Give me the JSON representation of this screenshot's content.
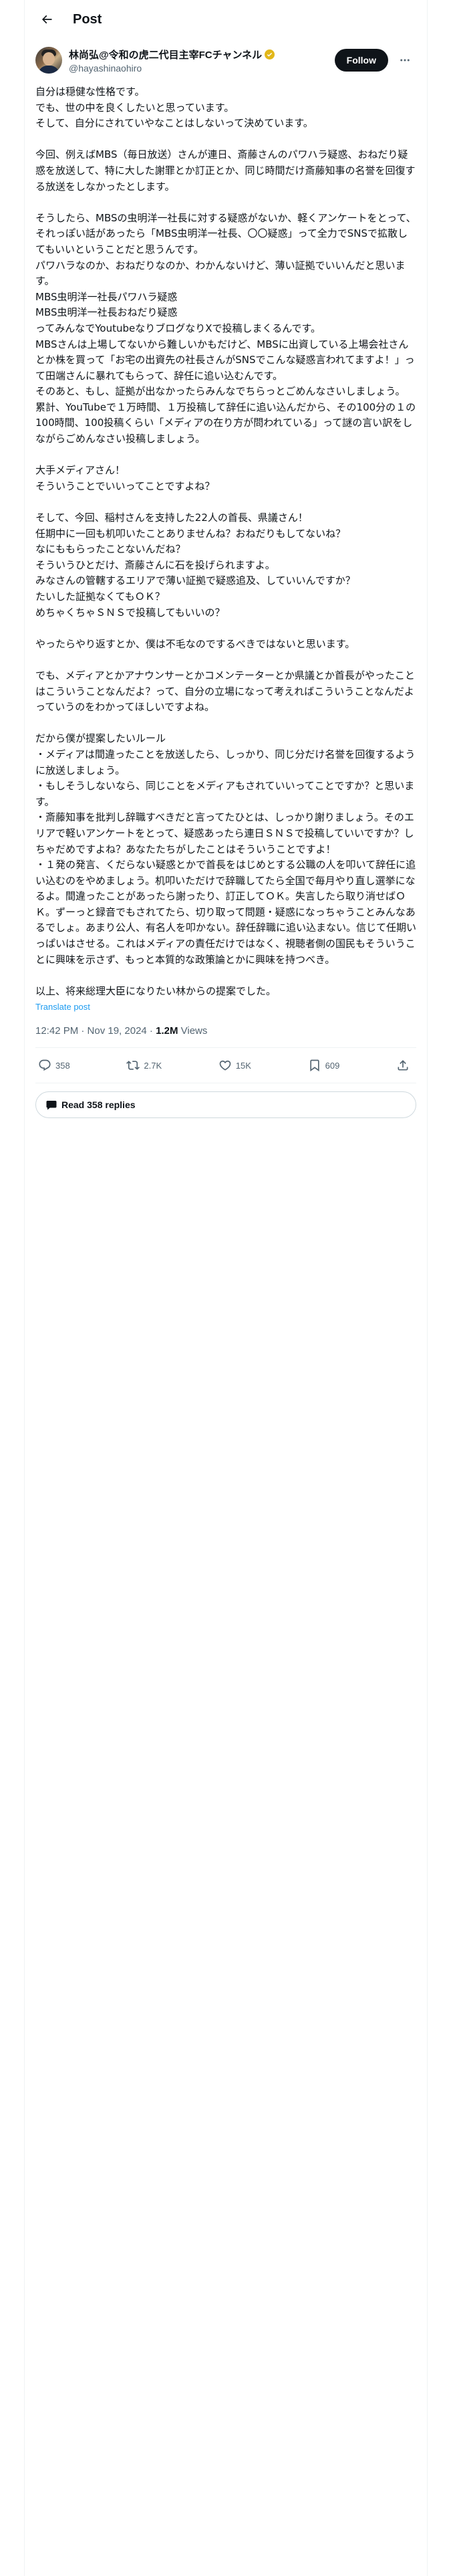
{
  "header": {
    "title": "Post"
  },
  "author": {
    "display_name": "林尚弘@令和の虎二代目主宰FCチャンネル",
    "handle": "@hayashinaohiro",
    "follow_label": "Follow",
    "badge_color": "#e2b719"
  },
  "post": {
    "text": "自分は穏健な性格です。\nでも、世の中を良くしたいと思っています。\nそして、自分にされていやなことはしないって決めています。\n\n今回、例えばMBS（毎日放送）さんが連日、斎藤さんのパワハラ疑惑、おねだり疑惑を放送して、特に大した謝罪とか訂正とか、同じ時間だけ斎藤知事の名誉を回復する放送をしなかったとします。\n\nそうしたら、MBSの虫明洋一社長に対する疑惑がないか、軽くアンケートをとって、それっぽい話があったら「MBS虫明洋一社長、〇〇疑惑」って全力でSNSで拡散してもいいということだと思うんです。\nパワハラなのか、おねだりなのか、わかんないけど、薄い証拠でいいんだと思います。\nMBS虫明洋一社長パワハラ疑惑\nMBS虫明洋一社長おねだり疑惑\nってみんなでYoutubeなりブログなりXで投稿しまくるんです。\nMBSさんは上場してないから難しいかもだけど、MBSに出資している上場会社さんとか株を買って「お宅の出資先の社長さんがSNSでこんな疑惑言われてますよ！」って田端さんに暴れてもらって、辞任に追い込むんです。\nそのあと、もし、証拠が出なかったらみんなでちらっとごめんなさいしましょう。\n累計、YouTubeで１万時間、１万投稿して辞任に追い込んだから、その100分の１の100時間、100投稿くらい「メディアの在り方が問われている」って謎の言い訳をしながらごめんなさい投稿しましょう。\n\n大手メディアさん！\nそういうことでいいってことですよね？\n\nそして、今回、稲村さんを支持した22人の首長、県議さん！\n任期中に一回も机叩いたことありませんね？おねだりもしてないね？\nなにももらったことないんだね？\nそういうひとだけ、斎藤さんに石を投げられますよ。\nみなさんの管轄するエリアで薄い証拠で疑惑追及、していいんですか？\nたいした証拠なくてもＯＫ？\nめちゃくちゃＳＮＳで投稿してもいいの？\n\nやったらやり返すとか、僕は不毛なのでするべきではないと思います。\n\nでも、メディアとかアナウンサーとかコメンテーターとか県議とか首長がやったことはこういうことなんだよ？って、自分の立場になって考えればこういうことなんだよっていうのをわかってほしいですよね。\n\nだから僕が提案したいルール\n・メディアは間違ったことを放送したら、しっかり、同じ分だけ名誉を回復するように放送しましょう。\n・もしそうしないなら、同じことをメディアもされていいってことですか？と思います。\n・斎藤知事を批判し辞職すべきだと言ってたひとは、しっかり謝りましょう。そのエリアで軽いアンケートをとって、疑惑あったら連日ＳＮＳで投稿していいですか？しちゃだめですよね？あなたたちがしたことはそういうことですよ！\n・１発の発言、くだらない疑惑とかで首長をはじめとする公職の人を叩いて辞任に追い込むのをやめましょう。机叩いただけで辞職してたら全国で毎月やり直し選挙になるよ。間違ったことがあったら謝ったり、訂正してＯＫ。失言したら取り消せばＯＫ。ずーっと録音でもされてたら、切り取って問題・疑惑になっちゃうことみんなあるでしょ。あまり公人、有名人を叩かない。辞任辞職に追い込まない。信じて任期いっぱいはさせる。これはメディアの責任だけではなく、視聴者側の国民もそういうことに興味を示さず、もっと本質的な政策論とかに興味を持つべき。\n\n以上、将来総理大臣になりたい林からの提案でした。",
    "translate_label": "Translate post",
    "timestamp": "12:42 PM · Nov 19, 2024 · ",
    "views_count": "1.2M",
    "views_label": " Views"
  },
  "actions": {
    "replies": "358",
    "reposts": "2.7K",
    "likes": "15K",
    "bookmarks": "609"
  },
  "read_replies_label": "Read 358 replies",
  "icons": {
    "back": "back-arrow-icon",
    "more": "more-dots-icon",
    "reply": "reply-icon",
    "repost": "repost-icon",
    "like": "heart-icon",
    "bookmark": "bookmark-icon",
    "share": "share-icon",
    "replies_bubble": "speech-bubble-icon"
  }
}
